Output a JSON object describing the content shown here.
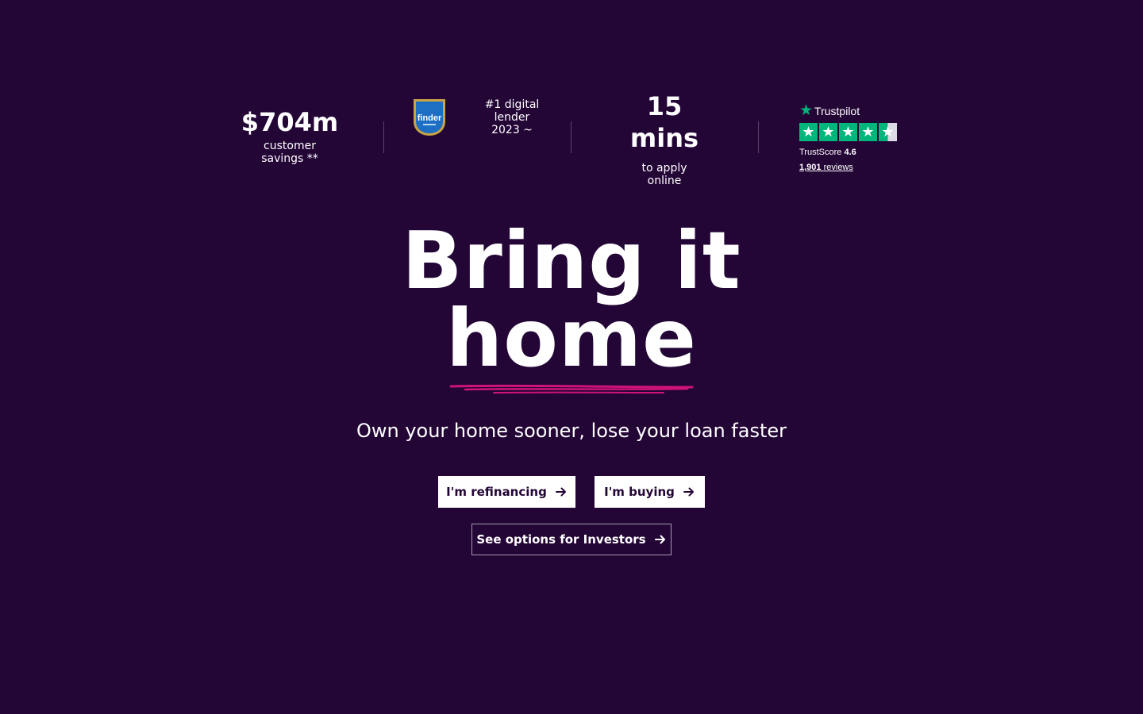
{
  "stats": {
    "savings": {
      "value": "$704m",
      "label_line1": "customer",
      "label_line2": "savings **"
    },
    "finder": {
      "badge_text": "finder",
      "badge_icon": "finder-award-badge-icon",
      "line1": "#1 digital",
      "line2": "lender",
      "line3": "2023 ~"
    },
    "apply": {
      "value_line1": "15",
      "value_line2": "mins",
      "label_line1": "to apply",
      "label_line2": "online"
    },
    "trustpilot": {
      "brand": "Trustpilot",
      "score_label": "TrustScore",
      "score": "4.6",
      "reviews_count": "1,901",
      "reviews_label": "reviews",
      "rating_stars": 4.5
    }
  },
  "hero": {
    "title_line1": "Bring it",
    "title_line2": "home",
    "subtitle": "Own your home sooner, lose your loan faster"
  },
  "actions": {
    "refinancing": "I'm refinancing",
    "buying": "I'm buying",
    "investors": "See options for Investors"
  },
  "colors": {
    "background": "#230536",
    "accent_pink": "#d0137a",
    "trustpilot_green": "#00b67a",
    "button_text": "#230536"
  }
}
